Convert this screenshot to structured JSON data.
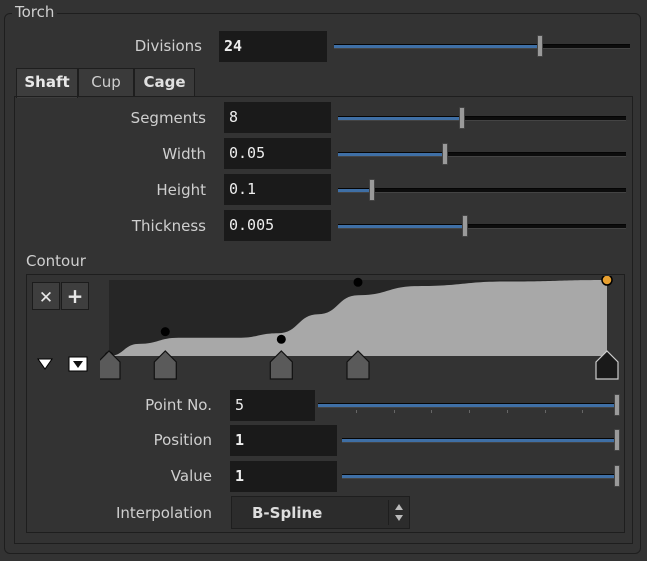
{
  "group": {
    "title": "Torch"
  },
  "divisions": {
    "label": "Divisions",
    "value": "24",
    "slider": 0.7
  },
  "tabs": [
    {
      "label": "Shaft",
      "active": true
    },
    {
      "label": "Cup",
      "active": false
    },
    {
      "label": "Cage",
      "active": false
    }
  ],
  "params": [
    {
      "label": "Segments",
      "value": "8",
      "slider": 0.43
    },
    {
      "label": "Width",
      "value": "0.05",
      "slider": 0.37
    },
    {
      "label": "Height",
      "value": "0.1",
      "slider": 0.11
    },
    {
      "label": "Thickness",
      "value": "0.005",
      "slider": 0.44
    }
  ],
  "contour": {
    "label": "Contour",
    "delete_icon": "close-icon",
    "add_icon": "plus-icon",
    "collapse_icon": "triangle-down-icon",
    "menu_icon": "arrow-down-box-icon",
    "ramp_points": [
      {
        "pos": 0.0,
        "value": 0.0
      },
      {
        "pos": 0.113,
        "value": 0.32
      },
      {
        "pos": 0.346,
        "value": 0.22
      },
      {
        "pos": 0.5,
        "value": 0.97
      },
      {
        "pos": 1.0,
        "value": 1.0
      }
    ],
    "selected_point": 5,
    "selected_color": "#e8a030",
    "fill_color": "#a8a8a8",
    "background_color": "#262626"
  },
  "point_no": {
    "label": "Point No.",
    "value": "5",
    "slider": 1.0
  },
  "position": {
    "label": "Position",
    "value": "1",
    "slider": 1.0
  },
  "value": {
    "label": "Value",
    "value": "1",
    "slider": 1.0
  },
  "interpolation": {
    "label": "Interpolation",
    "selected": "B-Spline"
  },
  "colors": {
    "accent": "#3f6fa5",
    "field_bg": "#1a1a1a",
    "panel_bg": "#333333"
  }
}
